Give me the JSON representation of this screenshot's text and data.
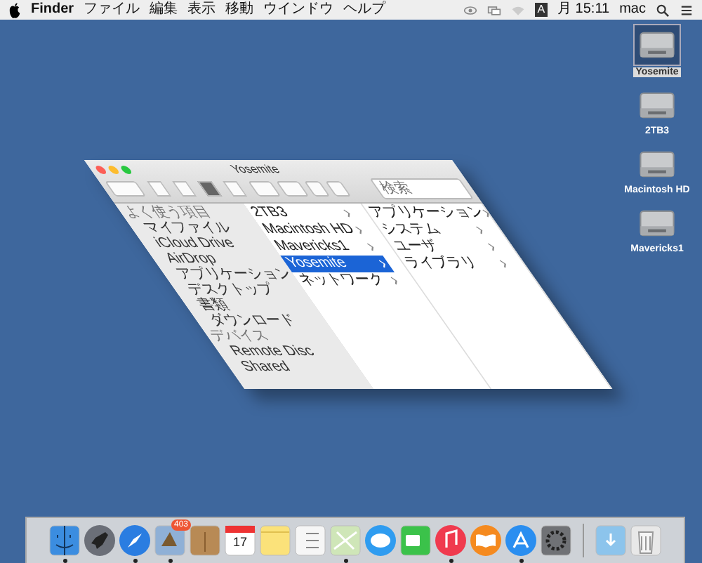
{
  "menu_bar": {
    "app": "Finder",
    "menus": [
      "ファイル",
      "編集",
      "表示",
      "移動",
      "ウインドウ",
      "ヘルプ"
    ],
    "input_source": "A",
    "clock": "月 15:11",
    "user": "mac"
  },
  "desktop_icons": [
    {
      "label": "Yosemite",
      "selected": true
    },
    {
      "label": "2TB3",
      "selected": false
    },
    {
      "label": "Macintosh HD",
      "selected": false
    },
    {
      "label": "Mavericks1",
      "selected": false
    }
  ],
  "finder_window": {
    "title": "Yosemite",
    "view_buttons": [
      {
        "selected": false
      },
      {
        "selected": false
      },
      {
        "selected": true
      },
      {
        "selected": false
      }
    ],
    "search": {
      "placeholder": "検索"
    },
    "sidebar": [
      {
        "kind": "header",
        "label": "よく使う項目"
      },
      {
        "kind": "item",
        "label": "マイファイル"
      },
      {
        "kind": "item",
        "label": "iCloud Drive"
      },
      {
        "kind": "item",
        "label": "AirDrop"
      },
      {
        "kind": "item",
        "label": "アプリケーション"
      },
      {
        "kind": "item",
        "label": "デスクトップ"
      },
      {
        "kind": "item",
        "label": "書類"
      },
      {
        "kind": "item",
        "label": "ダウンロード"
      },
      {
        "kind": "header",
        "label": "デバイス"
      },
      {
        "kind": "item",
        "label": "Remote Disc"
      },
      {
        "kind": "item",
        "label": "Shared"
      }
    ],
    "columns": [
      [
        {
          "label": "2TB3",
          "selected": false,
          "expandable": true
        },
        {
          "label": "Macintosh HD",
          "selected": false,
          "expandable": true
        },
        {
          "label": "Mavericks1",
          "selected": false,
          "expandable": true
        },
        {
          "label": "Yosemite",
          "selected": true,
          "expandable": true
        },
        {
          "label": "ネットワーク",
          "selected": false,
          "expandable": true
        }
      ],
      [
        {
          "label": "アプリケーション",
          "selected": false,
          "expandable": true
        },
        {
          "label": "システム",
          "selected": false,
          "expandable": true
        },
        {
          "label": "ユーザ",
          "selected": false,
          "expandable": true
        },
        {
          "label": "ライブラリ",
          "selected": false,
          "expandable": true
        }
      ]
    ]
  },
  "dock": {
    "items": [
      {
        "kind": "finder",
        "running": true
      },
      {
        "kind": "launchpad",
        "running": false
      },
      {
        "kind": "safari",
        "running": true
      },
      {
        "kind": "mail",
        "running": true,
        "badge": "403"
      },
      {
        "kind": "contacts",
        "running": false
      },
      {
        "kind": "calendar",
        "running": false,
        "date": "17"
      },
      {
        "kind": "notes",
        "running": false
      },
      {
        "kind": "reminders",
        "running": false
      },
      {
        "kind": "maps",
        "running": true
      },
      {
        "kind": "messages",
        "running": false
      },
      {
        "kind": "facetime",
        "running": false
      },
      {
        "kind": "itunes",
        "running": true
      },
      {
        "kind": "ibooks",
        "running": false
      },
      {
        "kind": "appstore",
        "running": true
      },
      {
        "kind": "preferences",
        "running": false
      },
      {
        "kind": "separator"
      },
      {
        "kind": "downloads",
        "running": false
      },
      {
        "kind": "trash",
        "running": false
      }
    ]
  }
}
